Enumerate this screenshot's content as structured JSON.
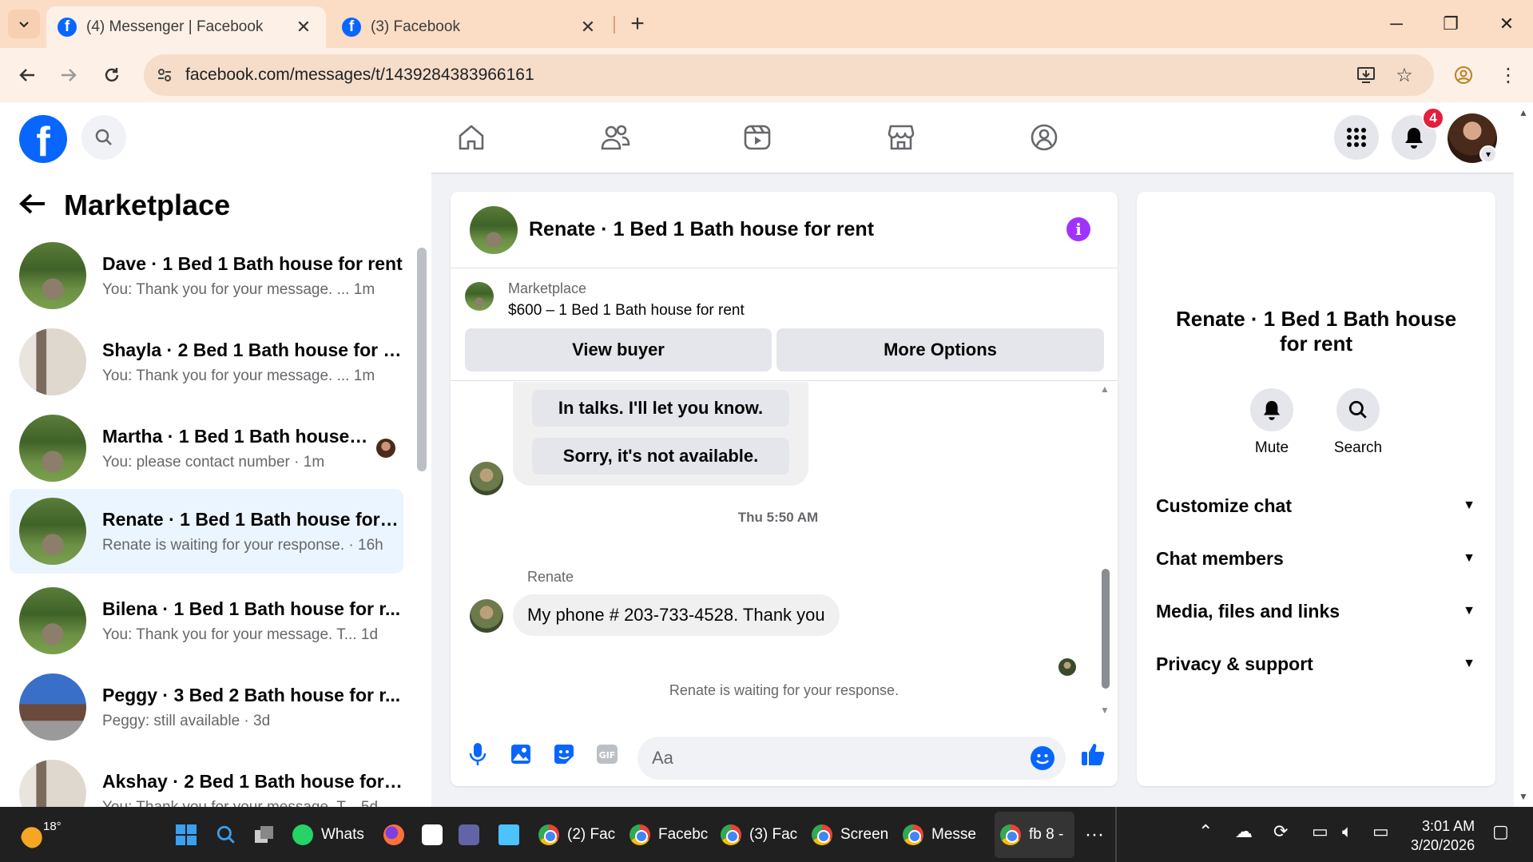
{
  "browser": {
    "tabs": [
      {
        "title": "(4) Messenger | Facebook",
        "active": true
      },
      {
        "title": "(3) Facebook",
        "active": false
      }
    ],
    "url": "facebook.com/messages/t/1439284383966161"
  },
  "header": {
    "logo": "f",
    "notification_count": "4",
    "nav_icons": [
      "home-icon",
      "friends-icon",
      "video-icon",
      "marketplace-icon",
      "groups-icon"
    ]
  },
  "sidebar": {
    "title": "Marketplace",
    "conversations": [
      {
        "name": "Dave · 1 Bed 1 Bath house for rent",
        "preview": "You: Thank you for your message. ...",
        "time": "1m"
      },
      {
        "name": "Shayla · 2 Bed 1 Bath house for r...",
        "preview": "You: Thank you for your message. ...",
        "time": "1m"
      },
      {
        "name": "Martha · 1 Bed 1 Bath house f...",
        "preview": "You: please contact number",
        "time": "1m"
      },
      {
        "name": "Renate · 1 Bed 1 Bath house for r...",
        "preview": "Renate is waiting for your response.",
        "time": "16h"
      },
      {
        "name": "Bilena · 1 Bed 1 Bath house for r...",
        "preview": "You: Thank you for your message. T...",
        "time": "1d"
      },
      {
        "name": "Peggy · 3 Bed 2 Bath house for r...",
        "preview": "Peggy: still available",
        "time": "3d"
      },
      {
        "name": "Akshay · 2 Bed 1 Bath house for ...",
        "preview": "You: Thank you for your message. T...",
        "time": "5d"
      }
    ]
  },
  "chat": {
    "title": "Renate · 1 Bed 1 Bath house for rent",
    "marketplace_label": "Marketplace",
    "listing": "$600 – 1 Bed 1 Bath house for rent",
    "view_buyer": "View buyer",
    "more_options": "More Options",
    "quick_replies": [
      "In talks. I'll let you know.",
      "Sorry, it's not available."
    ],
    "timestamp": "Thu 5:50 AM",
    "sender": "Renate",
    "message": "My phone # 203-733-4528. Thank you",
    "waiting": "Renate is waiting for your response.",
    "composer_placeholder": "Aa"
  },
  "info_panel": {
    "name": "Renate · 1 Bed 1 Bath house for rent",
    "mute": "Mute",
    "search": "Search",
    "sections": [
      "Customize chat",
      "Chat members",
      "Media, files and links",
      "Privacy & support"
    ]
  },
  "taskbar": {
    "weather": "18°",
    "apps": [
      "Whats",
      "(2) Fac",
      "Facebc",
      "(3) Fac",
      "Screen",
      "Messe",
      "fb 8 -"
    ],
    "time": "3:01 AM",
    "date": "3/20/2026"
  },
  "colors": {
    "facebook_blue": "#0866ff",
    "active_conversation": "#ebf5ff",
    "info_purple": "#a033ff",
    "badge_red": "#e41e3f"
  }
}
